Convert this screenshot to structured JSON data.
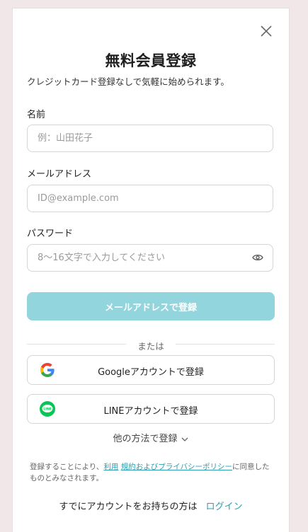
{
  "modal": {
    "title": "無料会員登録",
    "subtitle": "クレジットカード登録なしで気軽に始められます。"
  },
  "form": {
    "name_label": "名前",
    "name_placeholder": "例：山田花子",
    "email_label": "メールアドレス",
    "email_placeholder": "ID@example.com",
    "password_label": "パスワード",
    "password_placeholder": "8〜16文字で入力してください",
    "submit_label": "メールアドレスで登録"
  },
  "divider_text": "または",
  "social": {
    "google_label": "Googleアカウントで登録",
    "line_label": "LINEアカウントで登録",
    "line_icon_text": "LINE"
  },
  "other_methods_label": "他の方法で登録",
  "terms": {
    "prefix": "登録することにより、",
    "terms_link": "利用",
    "middle": "規約およびプライバシーポリシー",
    "suffix": "に同意したものとみなされます。"
  },
  "login_prompt": {
    "text": "すでにアカウントをお持ちの方は",
    "link": "ログイン"
  },
  "colors": {
    "background": "#f1e7e8",
    "primary_button": "#92d5dd",
    "link": "#2b9fb1",
    "line_green": "#06c755"
  },
  "icons": {
    "close": "close-icon",
    "eye": "eye-icon",
    "google": "google-icon",
    "line": "line-icon",
    "chevron": "chevron-down-icon"
  }
}
